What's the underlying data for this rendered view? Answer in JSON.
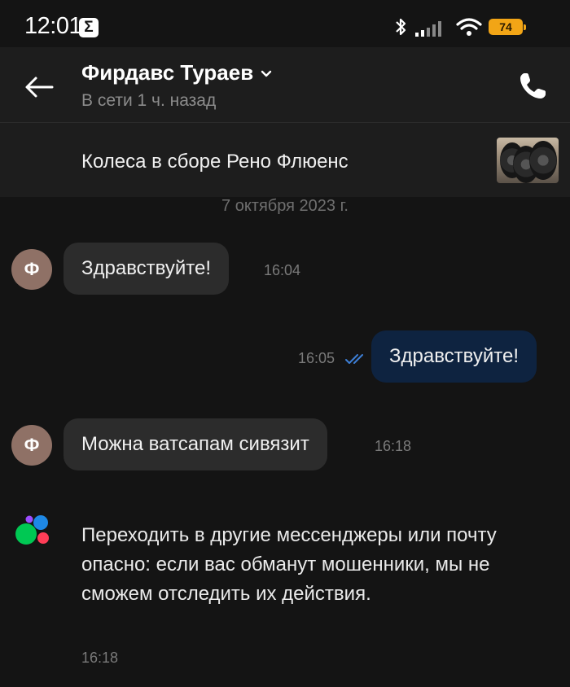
{
  "status_bar": {
    "time": "12:01",
    "notification_icon": "sigma-icon",
    "battery": "74",
    "colors": {
      "battery": "#f2a516"
    }
  },
  "header": {
    "contact_name": "Фирдавс Тураев",
    "status": "В сети 1 ч. назад"
  },
  "listing": {
    "title": "Колеса в сборе Рено Флюенс",
    "thumbnail": "tires-photo"
  },
  "chat": {
    "date": "7 октября 2023 г.",
    "messages": [
      {
        "from": "contact",
        "avatar_letter": "Ф",
        "text": "Здравствуйте!",
        "time": "16:04"
      },
      {
        "from": "me",
        "text": "Здравствуйте!",
        "time": "16:05",
        "read": true
      },
      {
        "from": "contact",
        "avatar_letter": "Ф",
        "text": "Можна ватсапам сивязит",
        "time": "16:18"
      }
    ],
    "system_notice": {
      "text": "Переходить в другие мессенджеры или почту опасно: если вас обманут мошенники, мы не сможем отследить их действия.",
      "time": "16:18"
    }
  },
  "colors": {
    "background": "#141414",
    "header": "#1d1d1d",
    "incoming_bubble": "#2c2c2c",
    "outgoing_bubble": "#0e2340",
    "read_ticks": "#3d7fd6",
    "avatar": "#8f7166"
  }
}
